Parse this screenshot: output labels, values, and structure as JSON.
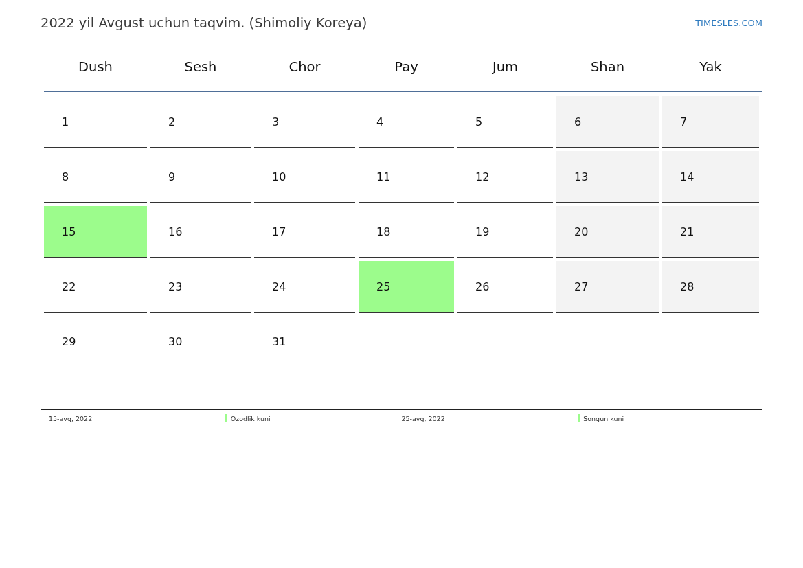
{
  "title": "2022 yil Avgust uchun taqvim. (Shimoliy Koreya)",
  "site_link": "TIMESLES.COM",
  "weekdays": [
    "Dush",
    "Sesh",
    "Chor",
    "Pay",
    "Jum",
    "Shan",
    "Yak"
  ],
  "weeks": [
    [
      {
        "day": "1",
        "weekend": false,
        "holiday": false
      },
      {
        "day": "2",
        "weekend": false,
        "holiday": false
      },
      {
        "day": "3",
        "weekend": false,
        "holiday": false
      },
      {
        "day": "4",
        "weekend": false,
        "holiday": false
      },
      {
        "day": "5",
        "weekend": false,
        "holiday": false
      },
      {
        "day": "6",
        "weekend": true,
        "holiday": false
      },
      {
        "day": "7",
        "weekend": true,
        "holiday": false
      }
    ],
    [
      {
        "day": "8",
        "weekend": false,
        "holiday": false
      },
      {
        "day": "9",
        "weekend": false,
        "holiday": false
      },
      {
        "day": "10",
        "weekend": false,
        "holiday": false
      },
      {
        "day": "11",
        "weekend": false,
        "holiday": false
      },
      {
        "day": "12",
        "weekend": false,
        "holiday": false
      },
      {
        "day": "13",
        "weekend": true,
        "holiday": false
      },
      {
        "day": "14",
        "weekend": true,
        "holiday": false
      }
    ],
    [
      {
        "day": "15",
        "weekend": false,
        "holiday": true
      },
      {
        "day": "16",
        "weekend": false,
        "holiday": false
      },
      {
        "day": "17",
        "weekend": false,
        "holiday": false
      },
      {
        "day": "18",
        "weekend": false,
        "holiday": false
      },
      {
        "day": "19",
        "weekend": false,
        "holiday": false
      },
      {
        "day": "20",
        "weekend": true,
        "holiday": false
      },
      {
        "day": "21",
        "weekend": true,
        "holiday": false
      }
    ],
    [
      {
        "day": "22",
        "weekend": false,
        "holiday": false
      },
      {
        "day": "23",
        "weekend": false,
        "holiday": false
      },
      {
        "day": "24",
        "weekend": false,
        "holiday": false
      },
      {
        "day": "25",
        "weekend": false,
        "holiday": true
      },
      {
        "day": "26",
        "weekend": false,
        "holiday": false
      },
      {
        "day": "27",
        "weekend": true,
        "holiday": false
      },
      {
        "day": "28",
        "weekend": true,
        "holiday": false
      }
    ],
    [
      {
        "day": "29",
        "weekend": false,
        "holiday": false
      },
      {
        "day": "30",
        "weekend": false,
        "holiday": false
      },
      {
        "day": "31",
        "weekend": false,
        "holiday": false
      },
      {
        "weekend": false,
        "holiday": false
      },
      {
        "weekend": false,
        "holiday": false
      },
      {
        "weekend": false,
        "holiday": false
      },
      {
        "weekend": false,
        "holiday": false
      }
    ]
  ],
  "legend": [
    {
      "date": "15-avg, 2022",
      "name": "Ozodlik kuni",
      "color": "#9cfc8c"
    },
    {
      "date": "25-avg, 2022",
      "name": "Songun kuni",
      "color": "#9cfc8c"
    }
  ]
}
